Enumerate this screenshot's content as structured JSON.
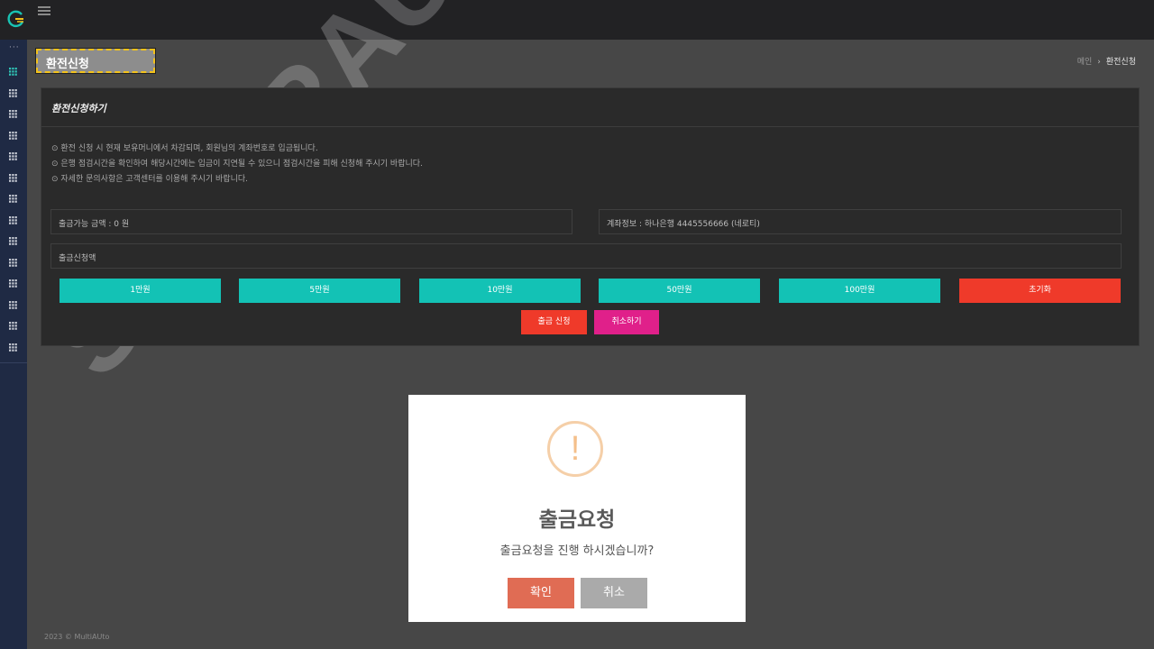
{
  "page_title": "환전신청",
  "breadcrumb": {
    "home": "메인",
    "separator": "›",
    "current": "환전신청"
  },
  "sidebar": {
    "dots": "···",
    "item_count": 14
  },
  "card": {
    "title": "환전신청하기",
    "notices": [
      "⊙ 환전 신청 시 현재 보유머니에서 차감되며, 회원님의 계좌번호로 입금됩니다.",
      "⊙ 은행 점검시간을 확인하여 해당시간에는 입금이 지연될 수 있으니 점검시간을 피해 신청해 주시기 바랍니다.",
      "⊙ 자세한 문의사항은 고객센터를 이용해 주시기 바랍니다."
    ],
    "available_amount": "출금가능 금액 : 0 원",
    "account_info": "계좌정보 : 하나은행 4445556666 (네로티)",
    "request_amount_placeholder": "출금신청액",
    "amount_buttons": [
      "1만원",
      "5만원",
      "10만원",
      "50만원",
      "100만원"
    ],
    "reset_button": "초기화",
    "submit_button": "출금 신청",
    "cancel_button": "취소하기"
  },
  "watermark": "SUPERAUTO",
  "footer": "2023 © MultiAUto",
  "modal": {
    "icon": "!",
    "title": "출금요청",
    "message": "출금요청을 진행 하시겠습니까?",
    "confirm": "확인",
    "cancel": "취소"
  },
  "colors": {
    "accent": "#13c2b5",
    "danger": "#ef3a2a",
    "submit": "#ef3a2a",
    "cancel": "#e0208a",
    "highlight_border": "#f3c21b",
    "sidebar_bg": "#1f2a44"
  }
}
